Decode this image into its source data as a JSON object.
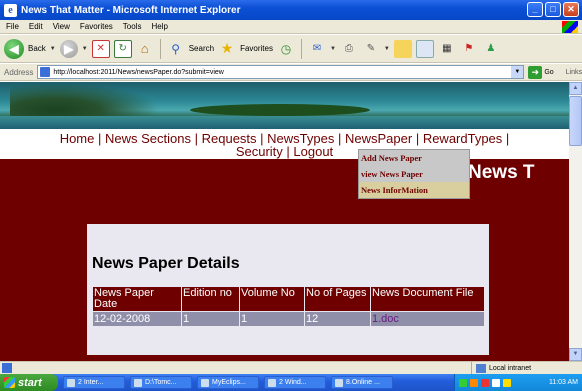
{
  "window": {
    "title": "News That Matter - Microsoft Internet Explorer",
    "buttons": {
      "minimize": "_",
      "maximize": "□",
      "close": "✕"
    }
  },
  "menu": [
    "File",
    "Edit",
    "View",
    "Favorites",
    "Tools",
    "Help"
  ],
  "toolbar": {
    "back_label": "Back",
    "search_label": "Search",
    "favorites_label": "Favorites"
  },
  "address": {
    "label": "Address",
    "url": "http://localhost:2011/News/newsPaper.do?submit=view",
    "go_label": "Go",
    "links_label": "Links"
  },
  "nav": {
    "row1": [
      "Home",
      "News Sections",
      "Requests",
      "NewsTypes",
      "NewsPaper",
      "RewardTypes"
    ],
    "row2": [
      "Security",
      "Logout"
    ]
  },
  "dropdown": {
    "items": [
      "Add News Paper",
      "view News Paper",
      "News InforMation"
    ],
    "active_index": 2
  },
  "header_partial": "News T",
  "panel": {
    "heading": "News Paper Details",
    "columns": [
      "News Paper Date",
      "Edition no",
      "Volume No",
      "No of Pages",
      "News Document File"
    ],
    "rows": [
      [
        "12-02-2008",
        "1",
        "1",
        "12",
        "1.doc"
      ]
    ]
  },
  "status": {
    "zone": "Local intranet"
  },
  "taskbar": {
    "start_label": "start",
    "tasks": [
      "2 Inter...",
      "D:\\Tomc...",
      "MyEclips...",
      "2 Wind...",
      "8.Online ..."
    ],
    "clock": "11:03 AM"
  }
}
